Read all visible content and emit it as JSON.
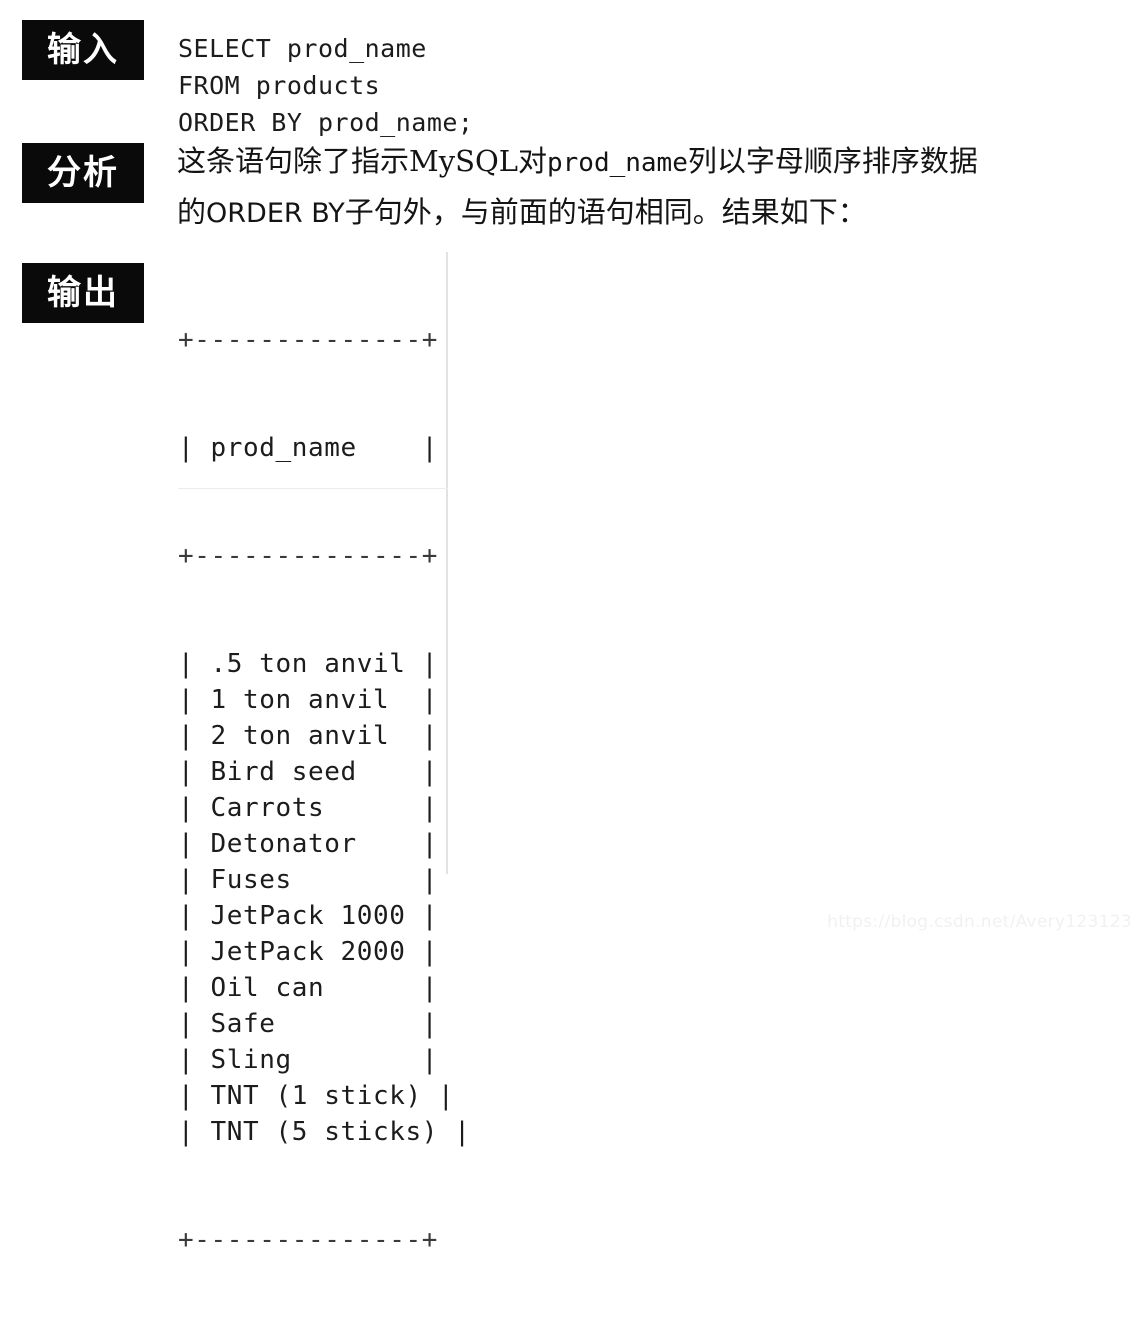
{
  "labels": {
    "input": "输入",
    "analysis": "分析",
    "output": "输出"
  },
  "sql": {
    "code": "SELECT prod_name\nFROM products\nORDER BY prod_name;"
  },
  "analysis": {
    "line1_a": "这条语句除了指示MySQL对",
    "line1_mono": "prod_name",
    "line1_b": "列以字母顺序排序数据",
    "line2_a": "的",
    "line2_mono": "ORDER BY",
    "line2_b": "子句外，与前面的语句相同。结果如下："
  },
  "result_table": {
    "top_border": "+--------------+",
    "header_row": "| prod_name    |",
    "header_sep": "+--------------+",
    "bottom_border": "+--------------+",
    "column_header": "prod_name",
    "row_count": 14,
    "rows": [
      "| .5 ton anvil |",
      "| 1 ton anvil  |",
      "| 2 ton anvil  |",
      "| Bird seed    |",
      "| Carrots      |",
      "| Detonator    |",
      "| Fuses        |",
      "| JetPack 1000 |",
      "| JetPack 2000 |",
      "| Oil can      |",
      "| Safe         |",
      "| Sling        |",
      "| TNT (1 stick) |",
      "| TNT (5 sticks) |"
    ],
    "values": [
      ".5 ton anvil",
      "1 ton anvil",
      "2 ton anvil",
      "Bird seed",
      "Carrots",
      "Detonator",
      "Fuses",
      "JetPack 1000",
      "JetPack 2000",
      "Oil can",
      "Safe",
      "Sling",
      "TNT (1 stick)",
      "TNT (5 sticks)"
    ]
  },
  "watermark": {
    "text": "https://blog.csdn.net/Avery123123"
  },
  "colors": {
    "tag_background": "#0a0a0a",
    "tag_text": "#ffffff",
    "body_text": "#1a1a1a",
    "page_background": "#ffffff",
    "watermark_text": "#f1f1f1"
  }
}
